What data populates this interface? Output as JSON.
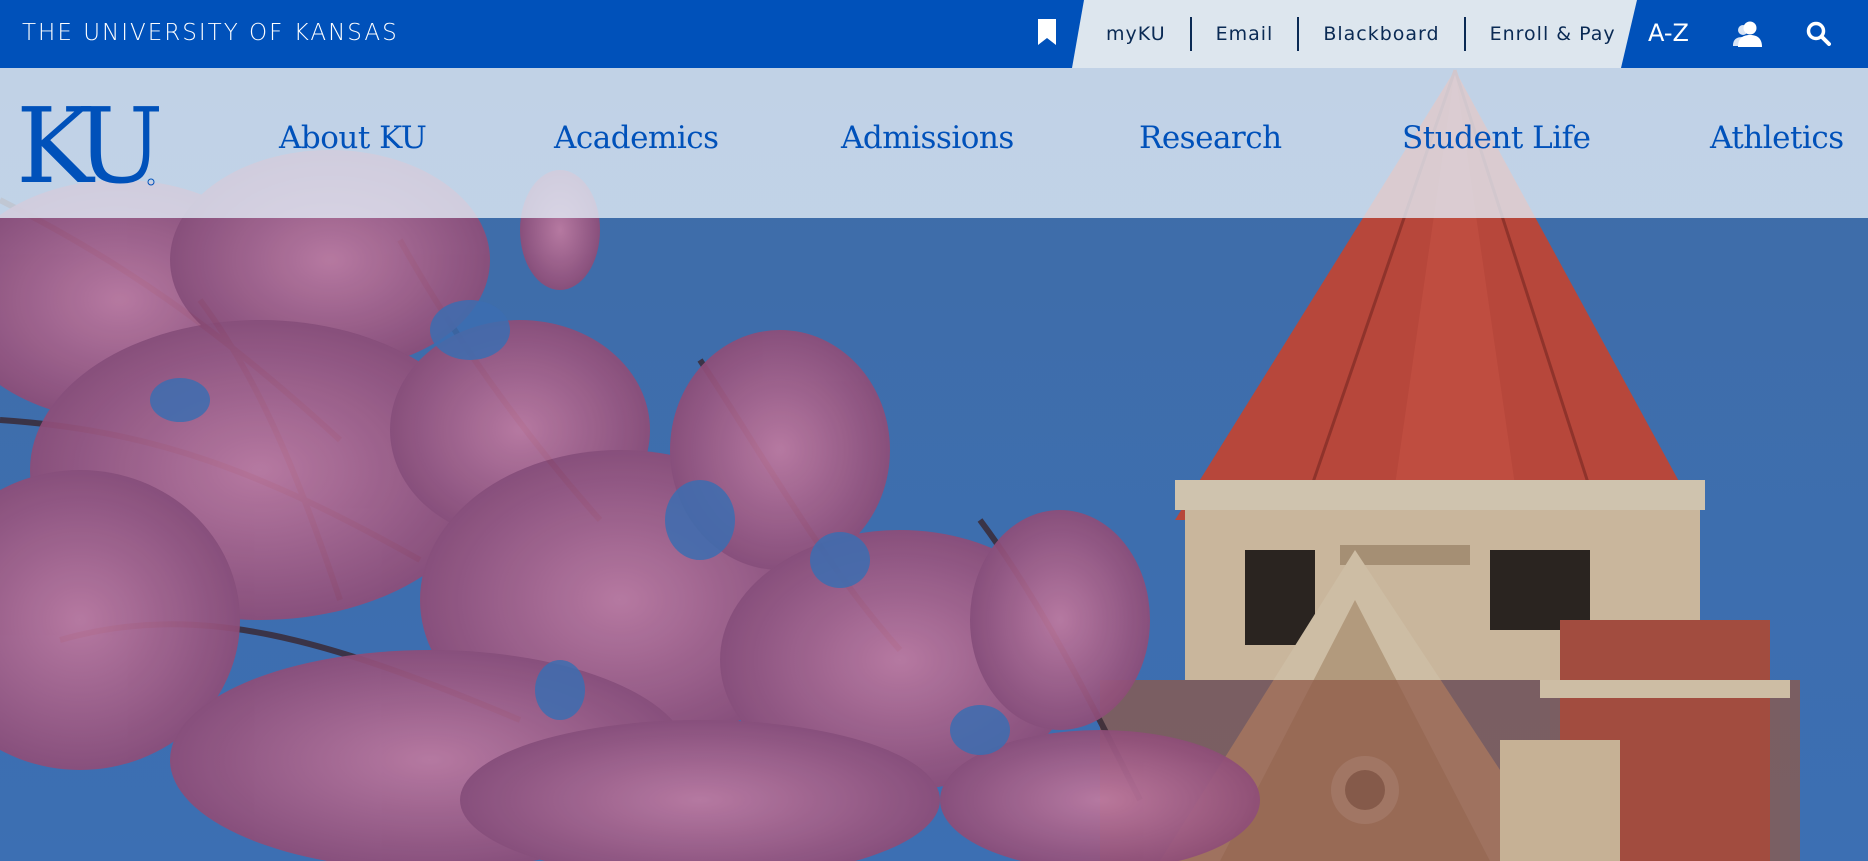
{
  "topbar": {
    "university_name": "THE UNIVERSITY OF KANSAS",
    "quick_links": [
      {
        "label": "myKU"
      },
      {
        "label": "Email"
      },
      {
        "label": "Blackboard"
      },
      {
        "label": "Enroll & Pay"
      }
    ],
    "az_label": "A-Z",
    "icons": [
      "bookmark-icon",
      "user-icon",
      "search-icon"
    ]
  },
  "mainnav": {
    "logo_text": "KU",
    "items": [
      {
        "label": "About KU"
      },
      {
        "label": "Academics"
      },
      {
        "label": "Admissions"
      },
      {
        "label": "Research"
      },
      {
        "label": "Student Life"
      },
      {
        "label": "Athletics"
      }
    ]
  },
  "colors": {
    "ku_blue": "#0051ba",
    "quick_links_bg": "#dde6ee",
    "quick_links_text": "#0a2a54",
    "sky": "#3a6aa8",
    "roof": "#b8453a",
    "blossom": "#b2668e"
  }
}
